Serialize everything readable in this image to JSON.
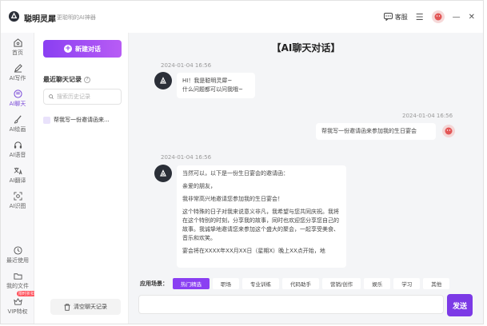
{
  "app": {
    "name": "聪明灵犀",
    "slogan": "更聪明的AI神器",
    "customer_service": "客服"
  },
  "rail": {
    "items": [
      {
        "label": "首页",
        "icon": "home-icon"
      },
      {
        "label": "AI写作",
        "icon": "pen-icon"
      },
      {
        "label": "AI聊天",
        "icon": "chat-icon"
      },
      {
        "label": "AI绘画",
        "icon": "brush-icon"
      },
      {
        "label": "AI语音",
        "icon": "headphone-icon"
      },
      {
        "label": "AI翻译",
        "icon": "translate-icon"
      },
      {
        "label": "AI识图",
        "icon": "scan-icon"
      },
      {
        "label": "最近使用",
        "icon": "clock-icon"
      },
      {
        "label": "我的文件",
        "icon": "folder-icon"
      },
      {
        "label": "VIP特权",
        "icon": "vip-icon"
      }
    ],
    "vip_badge": "限时折扣"
  },
  "history": {
    "new_chat": "新建对话",
    "recent_title": "最近聊天记录",
    "search_placeholder": "搜索历史记录",
    "items": [
      "帮我写一份邀请函来..."
    ],
    "clear": "清空聊天记录"
  },
  "chat": {
    "title": "【AI聊天对话】",
    "messages": [
      {
        "time": "2024-01-04 16:56",
        "role": "bot",
        "lines": [
          "HI！我是聪明灵犀~",
          "什么问题都可以问我哦~"
        ]
      },
      {
        "time": "2024-01-04 16:56",
        "role": "user",
        "lines": [
          "帮我写一份邀请函来参加我的生日宴会"
        ]
      },
      {
        "time": "2024-01-04 16:56",
        "role": "bot",
        "paragraphs": [
          "当然可以，以下是一份生日宴会的邀请函：",
          "亲爱的朋友，",
          "我非常高兴地邀请您参加我的生日宴会！",
          "这个特殊的日子对我来说意义非凡，我希望与您共同庆祝。我将在这个特别的时刻，分享我的故事，同时也欢迎您分享您自己的故事。我诚挚地邀请您来参加这个盛大的聚会，一起享受美食、音乐和欢笑。",
          "宴会将在XXXX年XX月XX日（星期X）晚上XX点开始，地"
        ]
      }
    ],
    "scene_label": "应用场景：",
    "scenes": [
      "热门精选",
      "职场",
      "专业训练",
      "代码助手",
      "营销/创作",
      "娱乐",
      "学习",
      "其他"
    ],
    "send": "发送"
  },
  "colors": {
    "accent": "#8a3ff2",
    "chat_bg": "#f4f5f7"
  }
}
